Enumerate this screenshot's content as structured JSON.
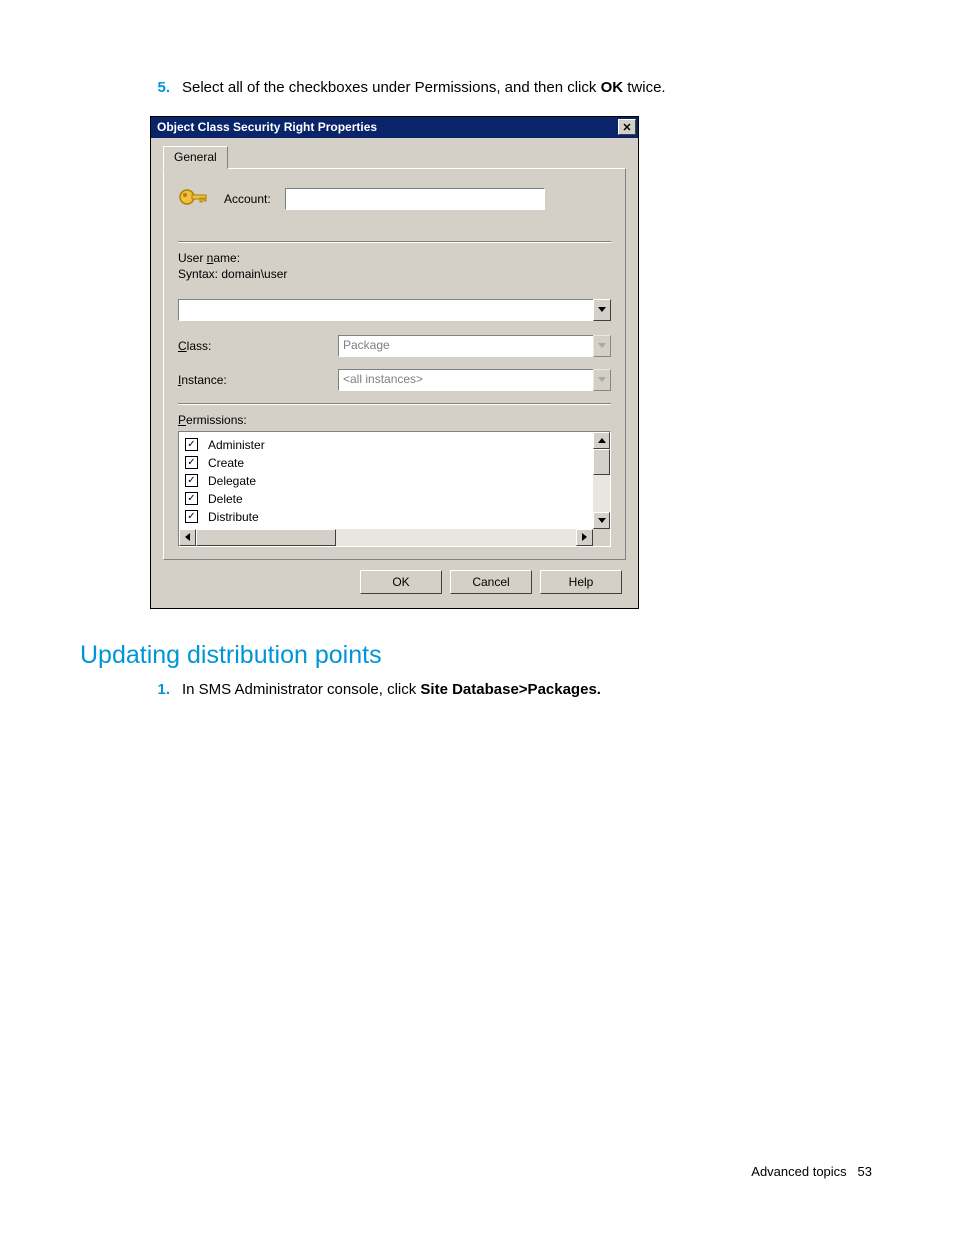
{
  "step5": {
    "number": "5.",
    "text_before": "Select all of the checkboxes under Permissions, and then click ",
    "bold": "OK",
    "text_after": " twice."
  },
  "dialog": {
    "title": "Object Class Security Right Properties",
    "tab": "General",
    "account_label": "Account:",
    "username_label_prefix": "User ",
    "username_label_u": "n",
    "username_label_suffix": "ame:",
    "syntax": "Syntax: domain\\user",
    "username_value": "",
    "class_label_u": "C",
    "class_label_rest": "lass:",
    "class_value": "Package",
    "instance_label_u": "I",
    "instance_label_rest": "nstance:",
    "instance_value": "<all instances>",
    "perm_label_u": "P",
    "perm_label_rest": "ermissions:",
    "permissions": [
      {
        "checked": true,
        "label": "Administer"
      },
      {
        "checked": true,
        "label": "Create"
      },
      {
        "checked": true,
        "label": "Delegate"
      },
      {
        "checked": true,
        "label": "Delete"
      },
      {
        "checked": true,
        "label": "Distribute"
      }
    ],
    "buttons": {
      "ok": "OK",
      "cancel": "Cancel",
      "help": "Help"
    }
  },
  "heading": "Updating distribution points",
  "step1": {
    "number": "1.",
    "text_before": "In SMS Administrator console, click ",
    "bold": "Site Database>Packages."
  },
  "footer": {
    "section": "Advanced topics",
    "page": "53"
  }
}
